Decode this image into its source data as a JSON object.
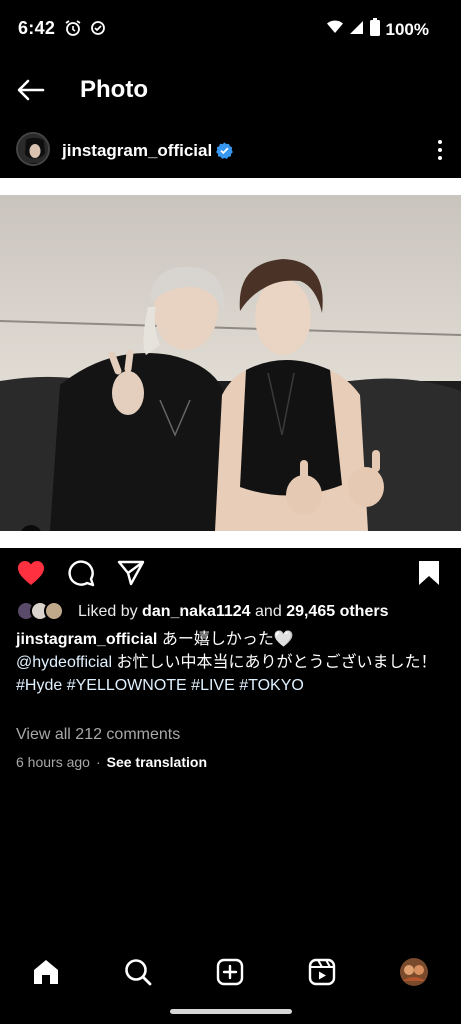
{
  "status_bar": {
    "time": "6:42",
    "battery": "100%",
    "icons": [
      "alarm-icon",
      "check-circle-icon",
      "wifi-icon",
      "signal-icon",
      "battery-icon"
    ]
  },
  "app_bar": {
    "title": "Photo",
    "back_icon": "arrow-left-icon"
  },
  "post": {
    "username": "jinstagram_official",
    "verified": true,
    "more_icon": "more-vertical-icon",
    "photo_icon": "person-tag-icon",
    "actions": {
      "liked": true,
      "icons": [
        "heart-icon",
        "comment-icon",
        "share-icon",
        "bookmark-icon"
      ]
    },
    "likes": {
      "prefix": "Liked by",
      "user": "dan_naka1124",
      "and": "and",
      "others": "29,465 others"
    },
    "caption": {
      "user": "jinstagram_official",
      "text1": "あー嬉しかった🤍",
      "mention": "@hydeofficial",
      "text2": "お忙しい中本当にありがとうございました！",
      "hashtags": "#Hyde #YELLOWNOTE #LIVE #TOKYO"
    },
    "comments_link": "View all 212 comments",
    "time_ago": "6 hours ago",
    "separator": "·",
    "see_translation": "See translation"
  },
  "bottom_nav": {
    "items": [
      "home-icon",
      "search-icon",
      "create-icon",
      "reels-icon",
      "profile-avatar"
    ]
  },
  "colors": {
    "background": "#000000",
    "like_red": "#ff3040",
    "verified_blue": "#3897f0",
    "link_tint": "#e0f1ff"
  }
}
